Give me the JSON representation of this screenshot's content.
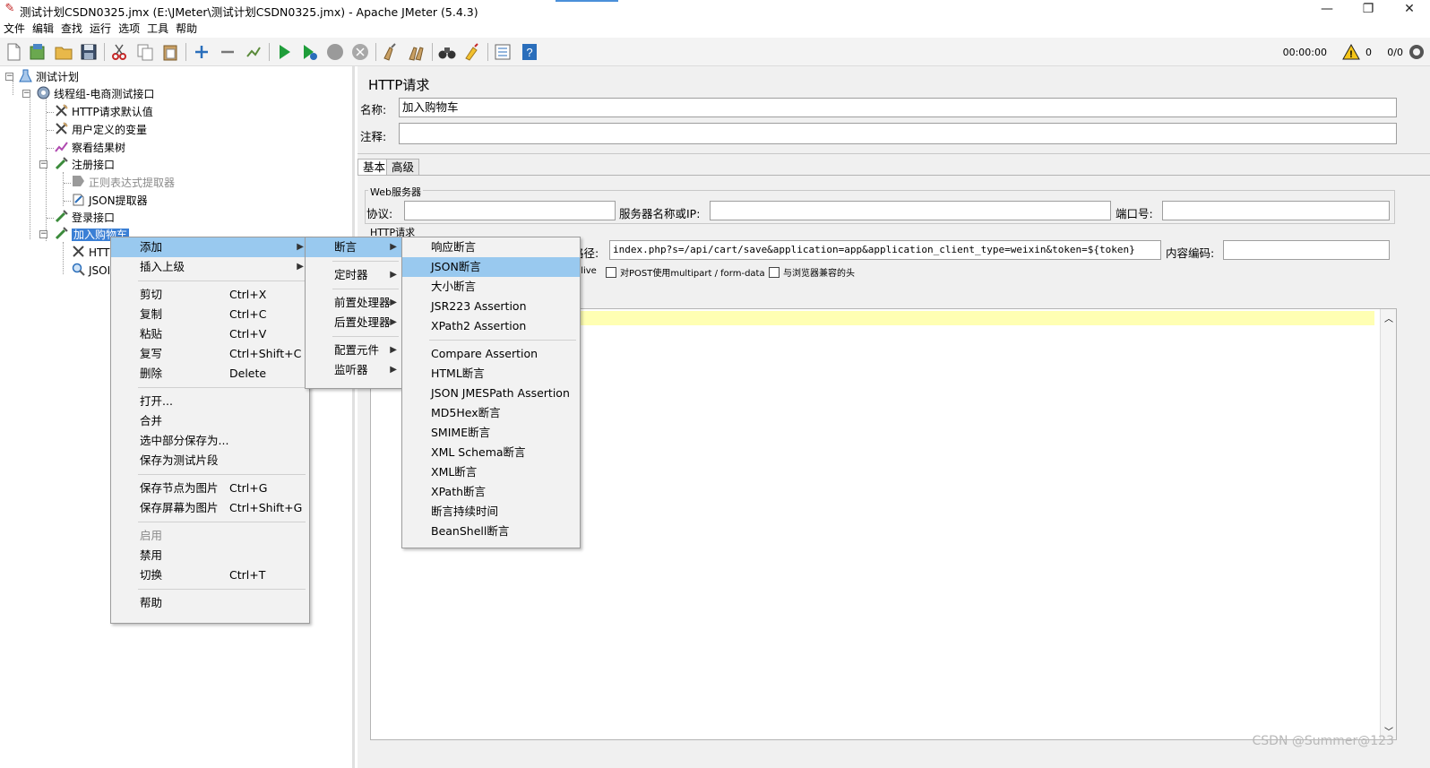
{
  "window": {
    "title": "测试计划CSDN0325.jmx (E:\\JMeter\\测试计划CSDN0325.jmx) - Apache JMeter (5.4.3)",
    "minimize": "—",
    "restore": "❐",
    "close": "✕"
  },
  "menubar": [
    "文件",
    "编辑",
    "查找",
    "运行",
    "选项",
    "工具",
    "帮助"
  ],
  "toolbar": {
    "timer": "00:00:00",
    "warning_count": "0",
    "threads": "0/0"
  },
  "tree": {
    "root": "测试计划",
    "thread_group": "线程组-电商测试接口",
    "items": {
      "http_defaults": "HTTP请求默认值",
      "user_vars": "用户定义的变量",
      "result_tree": "察看结果树",
      "register": "注册接口",
      "regex_extractor": "正则表达式提取器",
      "json_extractor": "JSON提取器",
      "login": "登录接口",
      "add_cart": "加入购物车",
      "child_http": "HTTP",
      "child_json": "JSOI"
    }
  },
  "panel": {
    "heading": "HTTP请求",
    "name_label": "名称:",
    "name_value": "加入购物车",
    "comment_label": "注释:",
    "comment_value": "",
    "tabs": [
      "基本",
      "高级"
    ],
    "web_server_title": "Web服务器",
    "protocol_label": "协议:",
    "server_label": "服务器名称或IP:",
    "port_label": "端口号:",
    "http_request_title": "HTTP请求",
    "path_label": "路径:",
    "path_value": "index.php?s=/api/cart/save&application=app&application_client_type=weixin&token=${token}",
    "encoding_label": "内容编码:",
    "keepalive_fragment": "pAlive",
    "multipart_label": "对POST使用multipart / form-data",
    "browser_headers_label": "与浏览器兼容的头"
  },
  "context_menu": {
    "items": [
      {
        "label": "添加",
        "submenu": true
      },
      {
        "label": "插入上级",
        "submenu": true
      },
      {
        "label": "剪切",
        "key": "Ctrl+X"
      },
      {
        "label": "复制",
        "key": "Ctrl+C"
      },
      {
        "label": "粘贴",
        "key": "Ctrl+V"
      },
      {
        "label": "复写",
        "key": "Ctrl+Shift+C"
      },
      {
        "label": "删除",
        "key": "Delete"
      },
      {
        "label": "打开..."
      },
      {
        "label": "合并"
      },
      {
        "label": "选中部分保存为..."
      },
      {
        "label": "保存为测试片段"
      },
      {
        "label": "保存节点为图片",
        "key": "Ctrl+G"
      },
      {
        "label": "保存屏幕为图片",
        "key": "Ctrl+Shift+G"
      },
      {
        "label": "启用"
      },
      {
        "label": "禁用"
      },
      {
        "label": "切换",
        "key": "Ctrl+T"
      },
      {
        "label": "帮助"
      }
    ]
  },
  "add_submenu": {
    "items": [
      "断言",
      "定时器",
      "前置处理器",
      "后置处理器",
      "配置元件",
      "监听器"
    ]
  },
  "assertion_submenu": {
    "items": [
      "响应断言",
      "JSON断言",
      "大小断言",
      "JSR223 Assertion",
      "XPath2 Assertion",
      "Compare Assertion",
      "HTML断言",
      "JSON JMESPath Assertion",
      "MD5Hex断言",
      "SMIME断言",
      "XML Schema断言",
      "XML断言",
      "XPath断言",
      "断言持续时间",
      "BeanShell断言"
    ]
  },
  "watermark": "CSDN @Summer@123"
}
